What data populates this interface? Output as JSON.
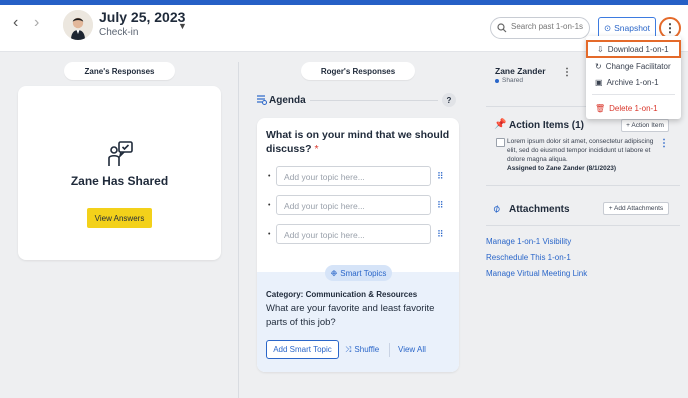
{
  "header": {
    "back_icon": "chevron-left-icon",
    "forward_icon": "chevron-right-icon",
    "date": "July 25, 2023",
    "subtitle": "Check-in",
    "search_placeholder": "Search past 1-on-1s",
    "snapshot_label": "Snapshot"
  },
  "left": {
    "tab_label": "Zane's Responses",
    "shared_title": "Zane Has Shared",
    "view_answers": "View Answers"
  },
  "center": {
    "tab_label": "Roger's Responses",
    "agenda_title": "Agenda",
    "help": "?",
    "question": "What is on your mind that we should discuss?",
    "required_mark": "*",
    "topic_placeholder": "Add your topic here...",
    "smart_topics_label": "Smart Topics",
    "category": "Category: Communication & Resources",
    "smart_question": "What are your favorite and least favorite parts of this job?",
    "add_smart_topic": "Add Smart Topic",
    "shuffle": "Shuffle",
    "view_all": "View All"
  },
  "right": {
    "participant_name": "Zane Zander",
    "participant_status": "Shared",
    "action_items_title": "Action Items (1)",
    "add_action_item": "+ Action Item",
    "action_item_text": "Lorem ipsum dolor sit amet, consectetur adipiscing elit, sed do eiusmod tempor incididunt ut labore et dolore magna aliqua.",
    "assigned_to": "Assigned to Zane Zander (8/1/2023)",
    "attachments_title": "Attachments",
    "add_attachments": "+ Add Attachments",
    "links": [
      "Manage 1-on-1 Visibility",
      "Reschedule This 1-on-1",
      "Manage Virtual Meeting Link"
    ]
  },
  "menu": {
    "items": [
      "Download 1-on-1",
      "Change Facilitator",
      "Archive 1-on-1",
      "Delete 1-on-1"
    ]
  },
  "colors": {
    "brand": "#2660c6",
    "accent_yellow": "#f3d11a",
    "delete_red": "#d9362b",
    "highlight_orange": "#e46a2a"
  }
}
